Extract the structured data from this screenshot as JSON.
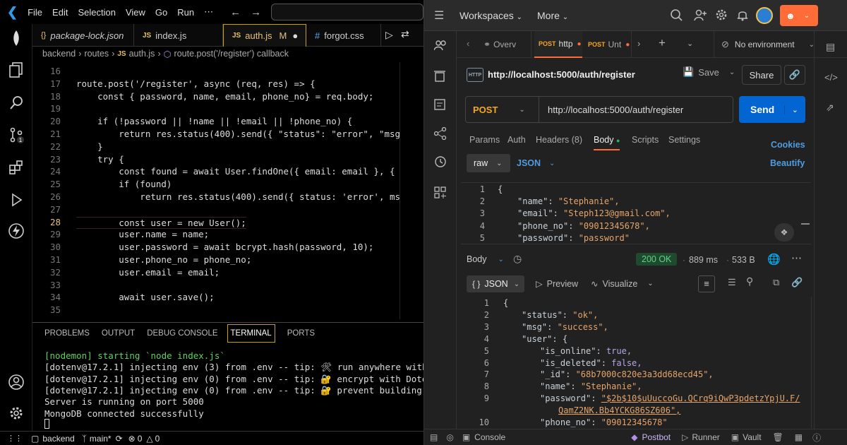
{
  "vscode": {
    "menu": [
      "File",
      "Edit",
      "Selection",
      "View",
      "Go",
      "Run",
      "⋯"
    ],
    "tabs": [
      {
        "icon": "{}",
        "label": "package-lock.json"
      },
      {
        "icon": "JS",
        "label": "index.js"
      },
      {
        "icon": "JS",
        "label": "auth.js",
        "badge": "M"
      },
      {
        "icon": "#",
        "label": "forgot.css"
      }
    ],
    "breadcrumbs": [
      "backend",
      "routes",
      "JS",
      "auth.js",
      "route.post('/register') callback"
    ],
    "code_lines": [
      {
        "n": "16",
        "t": ""
      },
      {
        "n": "17",
        "t": "route.post('/register', async (req, res) => {"
      },
      {
        "n": "18",
        "t": "    const { password, name, email, phone_no} = req.body;"
      },
      {
        "n": "19",
        "t": ""
      },
      {
        "n": "20",
        "t": "    if (!password || !name || !email || !phone_no) {"
      },
      {
        "n": "21",
        "t": "        return res.status(400).send({ \"status\": \"error\", \"msg\":"
      },
      {
        "n": "22",
        "t": "    }"
      },
      {
        "n": "23",
        "t": "    try {"
      },
      {
        "n": "24",
        "t": "        const found = await User.findOne({ email: email }, { em"
      },
      {
        "n": "25",
        "t": "        if (found)"
      },
      {
        "n": "26",
        "t": "            return res.status(400).send({ status: 'error', msg:"
      },
      {
        "n": "27",
        "t": ""
      },
      {
        "n": "28",
        "t": "        const user = new User();"
      },
      {
        "n": "29",
        "t": "        user.name = name;"
      },
      {
        "n": "30",
        "t": "        user.password = await bcrypt.hash(password, 10);"
      },
      {
        "n": "31",
        "t": "        user.phone_no = phone_no;"
      },
      {
        "n": "32",
        "t": "        user.email = email;"
      },
      {
        "n": "33",
        "t": ""
      },
      {
        "n": "34",
        "t": "        await user.save();"
      },
      {
        "n": "35",
        "t": ""
      }
    ],
    "panel_tabs": [
      "PROBLEMS",
      "OUTPUT",
      "DEBUG CONSOLE",
      "TERMINAL",
      "PORTS"
    ],
    "terminal_lines": [
      "[nodemon] starting `node index.js`",
      "[dotenv@17.2.1] injecting env (3) from .env -- tip: 🛠 run anywhere with `dote",
      "[dotenv@17.2.1] injecting env (0) from .env -- tip: 🔐 encrypt with Dotenvx: h",
      "[dotenv@17.2.1] injecting env (0) from .env -- tip: 🔐 prevent building .env i",
      "Server is running on port 5000",
      "MongoDB connected successfully"
    ],
    "status": {
      "folder": "backend",
      "branch": "main*",
      "errors": "0",
      "warnings": "0"
    }
  },
  "postman": {
    "workspaces": "Workspaces",
    "more": "More",
    "tabs": [
      {
        "label": "Overv"
      },
      {
        "method": "POST",
        "label": "http"
      },
      {
        "method": "POST",
        "label": "Unt"
      }
    ],
    "environment": "No environment",
    "request_title": "http://localhost:5000/auth/register",
    "save": "Save",
    "share": "Share",
    "method": "POST",
    "url": "http://localhost:5000/auth/register",
    "send": "Send",
    "req_tabs": [
      "Params",
      "Auth",
      "Headers (8)",
      "Body",
      "Scripts",
      "Settings"
    ],
    "cookies": "Cookies",
    "beautify": "Beautify",
    "body_mode": "raw",
    "body_type": "JSON",
    "req_body": [
      {
        "n": "1",
        "k": "",
        "v": "{"
      },
      {
        "n": "2",
        "k": "\"name\"",
        "v": "\"Stephanie\","
      },
      {
        "n": "3",
        "k": "\"email\"",
        "v": "\"Steph123@gmail.com\","
      },
      {
        "n": "4",
        "k": "\"phone_no\"",
        "v": "\"09012345678\","
      },
      {
        "n": "5",
        "k": "\"password\"",
        "v": "\"password\""
      }
    ],
    "response": {
      "label": "Body",
      "status": "200 OK",
      "time": "889 ms",
      "size": "533 B",
      "format": "JSON",
      "preview": "Preview",
      "visualize": "Visualize"
    },
    "res_body": [
      {
        "n": "1",
        "k": "",
        "v": "{",
        "c": "key",
        "i": 0
      },
      {
        "n": "2",
        "k": "\"status\"",
        "v": "\"ok\",",
        "c": "str",
        "i": 1
      },
      {
        "n": "3",
        "k": "\"msg\"",
        "v": "\"success\",",
        "c": "str",
        "i": 1
      },
      {
        "n": "4",
        "k": "\"user\"",
        "v": "{",
        "c": "key",
        "i": 1
      },
      {
        "n": "5",
        "k": "\"is_online\"",
        "v": "true,",
        "c": "bool",
        "i": 2
      },
      {
        "n": "6",
        "k": "\"is_deleted\"",
        "v": "false,",
        "c": "bool",
        "i": 2
      },
      {
        "n": "7",
        "k": "\"_id\"",
        "v": "\"68b7000c820e3a3dd68ecd45\",",
        "c": "str",
        "i": 2
      },
      {
        "n": "8",
        "k": "\"name\"",
        "v": "\"Stephanie\",",
        "c": "str",
        "i": 2
      },
      {
        "n": "9",
        "k": "\"password\"",
        "v": "\"$2b$10$uUuccoGu.QCrq9iQwP3pdetzYpjU.F/",
        "c": "str",
        "i": 2
      },
      {
        "n": "",
        "k": "",
        "v": "QamZ2NK.Bb4YCKG86SZ606\",",
        "c": "str",
        "i": 3
      },
      {
        "n": "10",
        "k": "\"phone_no\"",
        "v": "\"09012345678\"",
        "c": "str",
        "i": 2
      }
    ],
    "bottom": {
      "console": "Console",
      "postbot": "Postbot",
      "runner": "Runner",
      "vault": "Vault"
    }
  }
}
